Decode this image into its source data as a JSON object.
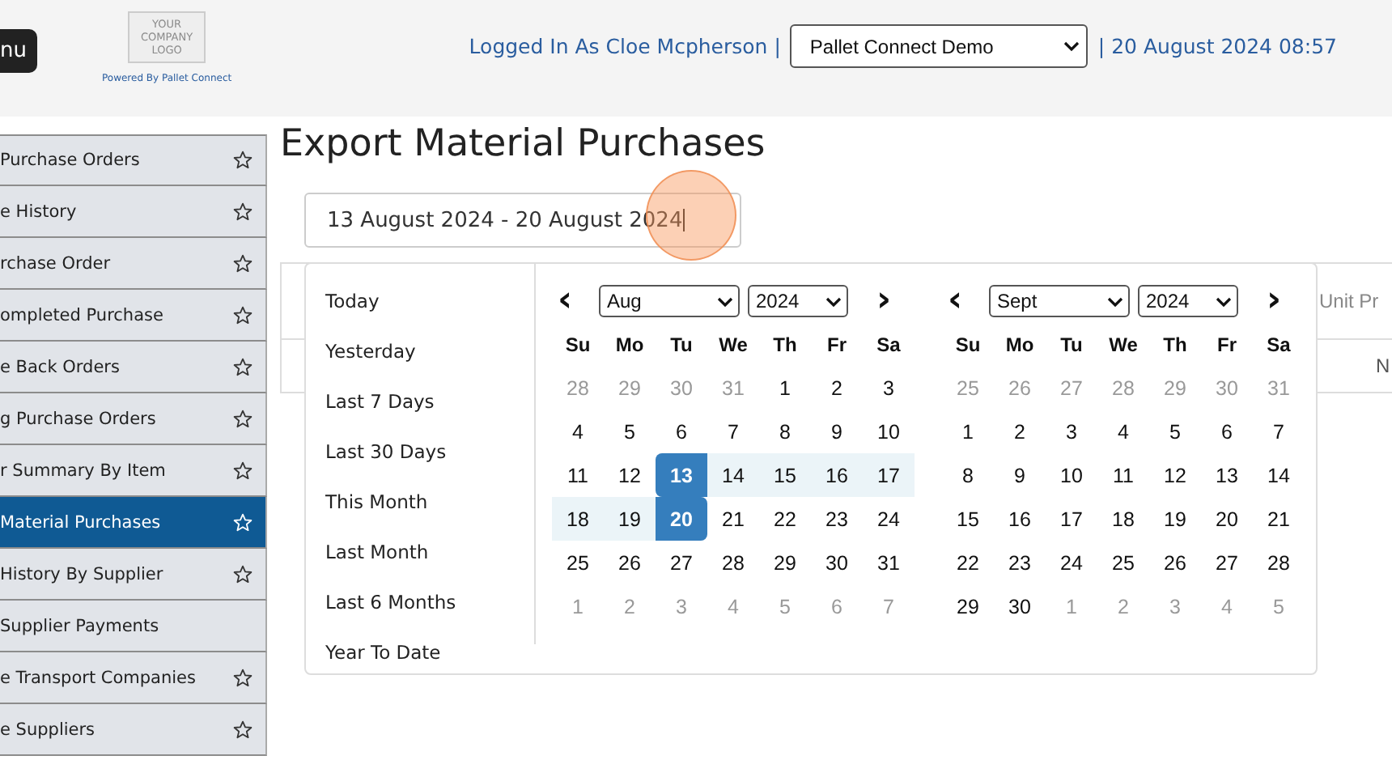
{
  "header": {
    "menu_button": "nu",
    "logo": {
      "lines": [
        "YOUR",
        "COMPANY",
        "LOGO"
      ],
      "powered_by": "Powered By Pallet Connect"
    },
    "user": "Logged In As Cloe Mcpherson |",
    "company_select": "Pallet Connect Demo",
    "datetime": "| 20 August 2024 08:57"
  },
  "sidebar": {
    "items": [
      {
        "label": "Purchase Orders",
        "starred": true,
        "selected": false
      },
      {
        "label": "e History",
        "starred": true,
        "selected": false
      },
      {
        "label": "rchase Order",
        "starred": true,
        "selected": false
      },
      {
        "label": "ompleted Purchase",
        "starred": true,
        "selected": false
      },
      {
        "label": "e Back Orders",
        "starred": true,
        "selected": false
      },
      {
        "label": "g Purchase Orders",
        "starred": true,
        "selected": false
      },
      {
        "label": "r Summary By Item",
        "starred": true,
        "selected": false
      },
      {
        "label": "Material Purchases",
        "starred": true,
        "selected": true
      },
      {
        "label": "History By Supplier",
        "starred": true,
        "selected": false
      },
      {
        "label": "Supplier Payments",
        "starred": false,
        "selected": false
      },
      {
        "label": "e Transport Companies",
        "starred": true,
        "selected": false
      },
      {
        "label": "e Suppliers",
        "starred": true,
        "selected": false
      }
    ]
  },
  "page": {
    "title": "Export Material Purchases",
    "date_range": {
      "value": "13 August 2024 - 20 August 2024",
      "focused": true
    },
    "click_highlight": true,
    "table": {
      "header_visible": "Unit Pr",
      "row_visible": "N"
    },
    "picker": {
      "ranges": [
        {
          "label": "Today",
          "selected": false
        },
        {
          "label": "Yesterday",
          "selected": false
        },
        {
          "label": "Last 7 Days",
          "selected": false
        },
        {
          "label": "Last 30 Days",
          "selected": false
        },
        {
          "label": "This Month",
          "selected": false
        },
        {
          "label": "Last Month",
          "selected": false
        },
        {
          "label": "Last 6 Months",
          "selected": false
        },
        {
          "label": "Year To Date",
          "selected": false
        }
      ],
      "calendars": [
        {
          "prev": "‹",
          "next": "›",
          "month": "Aug",
          "year": "2024",
          "weekdays": [
            "Su",
            "Mo",
            "Tu",
            "We",
            "Th",
            "Fr",
            "Sa"
          ],
          "weeks": [
            [
              {
                "day": "28",
                "kind": "off"
              },
              {
                "day": "29",
                "kind": "off"
              },
              {
                "day": "30",
                "kind": "off"
              },
              {
                "day": "31",
                "kind": "off"
              },
              {
                "day": "1",
                "kind": "day"
              },
              {
                "day": "2",
                "kind": "day"
              },
              {
                "day": "3",
                "kind": "day"
              }
            ],
            [
              {
                "day": "4",
                "kind": "day"
              },
              {
                "day": "5",
                "kind": "day"
              },
              {
                "day": "6",
                "kind": "day"
              },
              {
                "day": "7",
                "kind": "day"
              },
              {
                "day": "8",
                "kind": "day"
              },
              {
                "day": "9",
                "kind": "day"
              },
              {
                "day": "10",
                "kind": "day"
              }
            ],
            [
              {
                "day": "11",
                "kind": "day"
              },
              {
                "day": "12",
                "kind": "day"
              },
              {
                "day": "13",
                "kind": "start"
              },
              {
                "day": "14",
                "kind": "range"
              },
              {
                "day": "15",
                "kind": "range"
              },
              {
                "day": "16",
                "kind": "range"
              },
              {
                "day": "17",
                "kind": "range"
              }
            ],
            [
              {
                "day": "18",
                "kind": "range"
              },
              {
                "day": "19",
                "kind": "range"
              },
              {
                "day": "20",
                "kind": "end"
              },
              {
                "day": "21",
                "kind": "day"
              },
              {
                "day": "22",
                "kind": "day"
              },
              {
                "day": "23",
                "kind": "day"
              },
              {
                "day": "24",
                "kind": "day"
              }
            ],
            [
              {
                "day": "25",
                "kind": "day"
              },
              {
                "day": "26",
                "kind": "day"
              },
              {
                "day": "27",
                "kind": "day"
              },
              {
                "day": "28",
                "kind": "day"
              },
              {
                "day": "29",
                "kind": "day"
              },
              {
                "day": "30",
                "kind": "day"
              },
              {
                "day": "31",
                "kind": "day"
              }
            ],
            [
              {
                "day": "1",
                "kind": "off"
              },
              {
                "day": "2",
                "kind": "off"
              },
              {
                "day": "3",
                "kind": "off"
              },
              {
                "day": "4",
                "kind": "off"
              },
              {
                "day": "5",
                "kind": "off"
              },
              {
                "day": "6",
                "kind": "off"
              },
              {
                "day": "7",
                "kind": "off"
              }
            ]
          ]
        },
        {
          "prev": "‹",
          "next": "›",
          "month": "Sept",
          "year": "2024",
          "weekdays": [
            "Su",
            "Mo",
            "Tu",
            "We",
            "Th",
            "Fr",
            "Sa"
          ],
          "weeks": [
            [
              {
                "day": "25",
                "kind": "off"
              },
              {
                "day": "26",
                "kind": "off"
              },
              {
                "day": "27",
                "kind": "off"
              },
              {
                "day": "28",
                "kind": "off"
              },
              {
                "day": "29",
                "kind": "off"
              },
              {
                "day": "30",
                "kind": "off"
              },
              {
                "day": "31",
                "kind": "off"
              }
            ],
            [
              {
                "day": "1",
                "kind": "day"
              },
              {
                "day": "2",
                "kind": "day"
              },
              {
                "day": "3",
                "kind": "day"
              },
              {
                "day": "4",
                "kind": "day"
              },
              {
                "day": "5",
                "kind": "day"
              },
              {
                "day": "6",
                "kind": "day"
              },
              {
                "day": "7",
                "kind": "day"
              }
            ],
            [
              {
                "day": "8",
                "kind": "day"
              },
              {
                "day": "9",
                "kind": "day"
              },
              {
                "day": "10",
                "kind": "day"
              },
              {
                "day": "11",
                "kind": "day"
              },
              {
                "day": "12",
                "kind": "day"
              },
              {
                "day": "13",
                "kind": "day"
              },
              {
                "day": "14",
                "kind": "day"
              }
            ],
            [
              {
                "day": "15",
                "kind": "day"
              },
              {
                "day": "16",
                "kind": "day"
              },
              {
                "day": "17",
                "kind": "day"
              },
              {
                "day": "18",
                "kind": "day"
              },
              {
                "day": "19",
                "kind": "day"
              },
              {
                "day": "20",
                "kind": "day"
              },
              {
                "day": "21",
                "kind": "day"
              }
            ],
            [
              {
                "day": "22",
                "kind": "day"
              },
              {
                "day": "23",
                "kind": "day"
              },
              {
                "day": "24",
                "kind": "day"
              },
              {
                "day": "25",
                "kind": "day"
              },
              {
                "day": "26",
                "kind": "day"
              },
              {
                "day": "27",
                "kind": "day"
              },
              {
                "day": "28",
                "kind": "day"
              }
            ],
            [
              {
                "day": "29",
                "kind": "day"
              },
              {
                "day": "30",
                "kind": "day"
              },
              {
                "day": "1",
                "kind": "off"
              },
              {
                "day": "2",
                "kind": "off"
              },
              {
                "day": "3",
                "kind": "off"
              },
              {
                "day": "4",
                "kind": "off"
              },
              {
                "day": "5",
                "kind": "off"
              }
            ]
          ]
        }
      ]
    }
  }
}
